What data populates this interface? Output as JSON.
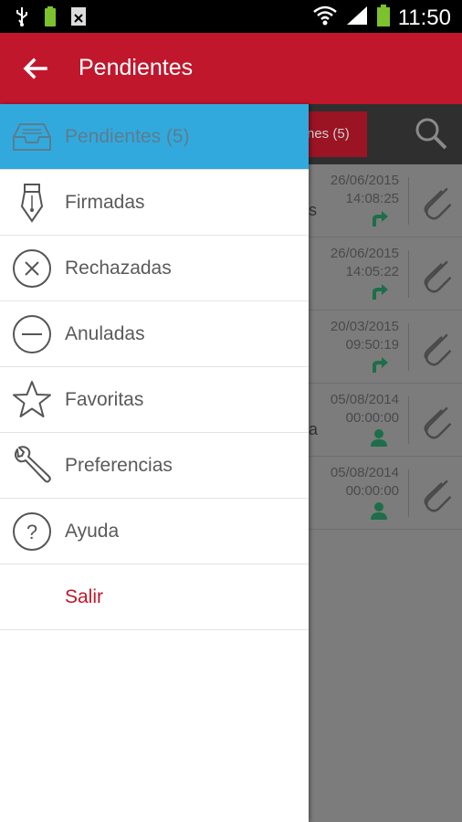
{
  "status_bar": {
    "time": "11:50",
    "icons": [
      "usb-icon",
      "battery-small-icon",
      "sim-icon",
      "wifi-icon",
      "signal-icon",
      "battery-icon"
    ]
  },
  "app_bar": {
    "title": "Pendientes",
    "back_icon": "arrow-left-icon"
  },
  "background_list": {
    "tab_label": "nes (5)",
    "search_icon": "search-icon",
    "rows": [
      {
        "date": "26/06/2015",
        "time": "14:08:25",
        "status_icon": "forward-arrow-icon",
        "edge_char": "s"
      },
      {
        "date": "26/06/2015",
        "time": "14:05:22",
        "status_icon": "forward-arrow-icon",
        "edge_char": ""
      },
      {
        "date": "20/03/2015",
        "time": "09:50:19",
        "status_icon": "forward-arrow-icon",
        "edge_char": ""
      },
      {
        "date": "05/08/2014",
        "time": "00:00:00",
        "status_icon": "person-icon",
        "edge_char": "a"
      },
      {
        "date": "05/08/2014",
        "time": "00:00:00",
        "status_icon": "person-icon",
        "edge_char": ""
      }
    ]
  },
  "drawer": {
    "items": [
      {
        "label": "Pendientes (5)",
        "icon": "inbox-tray-icon",
        "active": true
      },
      {
        "label": "Firmadas",
        "icon": "fountain-pen-icon"
      },
      {
        "label": "Rechazadas",
        "icon": "circle-x-icon"
      },
      {
        "label": "Anuladas",
        "icon": "circle-minus-icon"
      },
      {
        "label": "Favoritas",
        "icon": "star-icon"
      },
      {
        "label": "Preferencias",
        "icon": "wrench-icon"
      },
      {
        "label": "Ayuda",
        "icon": "help-circle-icon"
      },
      {
        "label": "Salir",
        "icon": ""
      }
    ]
  },
  "colors": {
    "brand_red": "#c0172d",
    "active_blue": "#32a9dd",
    "status_green": "#1d6e49"
  }
}
